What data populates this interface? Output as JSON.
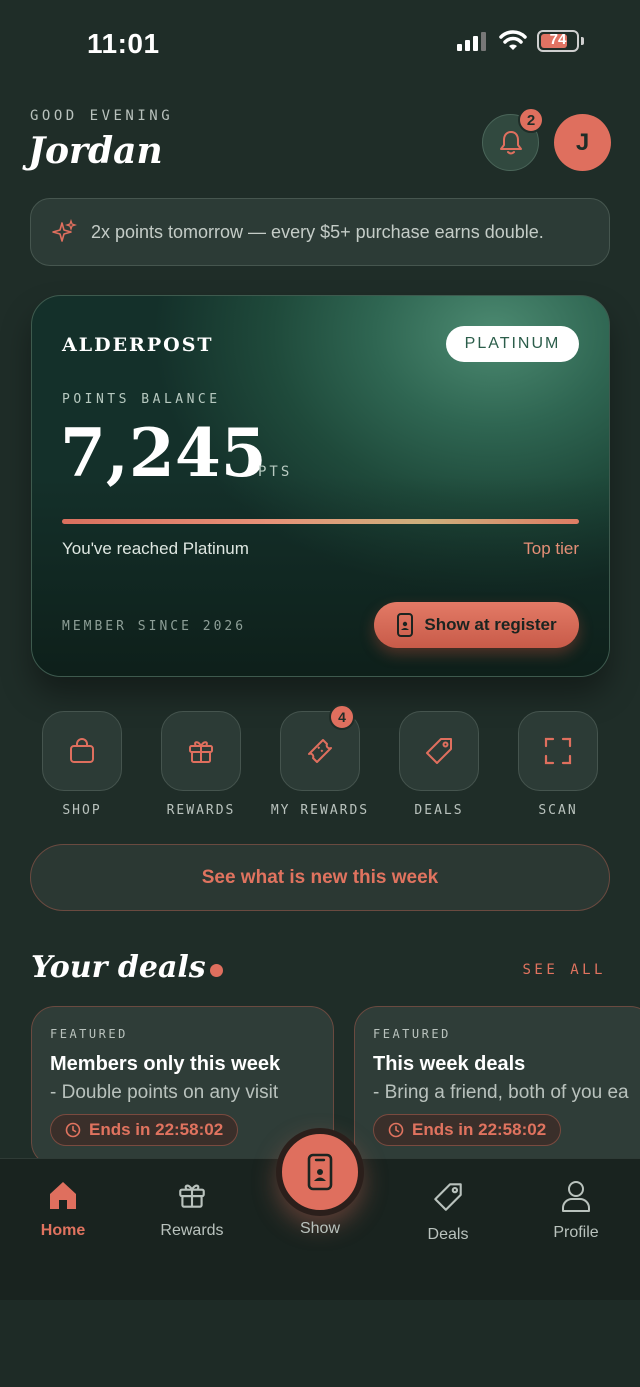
{
  "status_bar": {
    "time": "11:01",
    "battery": "74"
  },
  "header": {
    "greeting": "GOOD EVENING",
    "name": "Jordan",
    "notification_count": "2",
    "avatar_initial": "J"
  },
  "promo": {
    "text": "2x points tomorrow — every $5+ purchase earns double."
  },
  "card": {
    "brand": "ALDERPOST",
    "tier": "PLATINUM",
    "points_label": "POINTS BALANCE",
    "points": "7,245",
    "points_unit": "PTS",
    "progress_fraction": 1.0,
    "tier_message": "You've reached Platinum",
    "tier_next": "Top tier",
    "member_since": "MEMBER SINCE 2026",
    "register_button": "Show at register"
  },
  "quick_actions": [
    {
      "label": "SHOP",
      "icon": "shopping-bag-icon"
    },
    {
      "label": "REWARDS",
      "icon": "gift-icon"
    },
    {
      "label": "MY REWARDS",
      "icon": "ticket-icon",
      "badge": "4"
    },
    {
      "label": "DEALS",
      "icon": "tag-icon"
    },
    {
      "label": "SCAN",
      "icon": "scan-icon"
    }
  ],
  "whats_new": "See what is new this week",
  "deals": {
    "title": "Your deals",
    "see_all": "SEE ALL",
    "items": [
      {
        "tag": "FEATURED",
        "title": "Members only this week",
        "description": "- Double points on any visit",
        "timer": "Ends in 22:58:02"
      },
      {
        "tag": "FEATURED",
        "title": "This week deals",
        "description": "- Bring a friend, both of you ea",
        "timer": "Ends in 22:58:02"
      }
    ]
  },
  "tabbar": {
    "home": "Home",
    "rewards": "Rewards",
    "show": "Show",
    "deals": "Deals",
    "profile": "Profile"
  },
  "colors": {
    "accent": "#df6f5e",
    "background": "#1f2d28",
    "card": "#2f6652"
  }
}
